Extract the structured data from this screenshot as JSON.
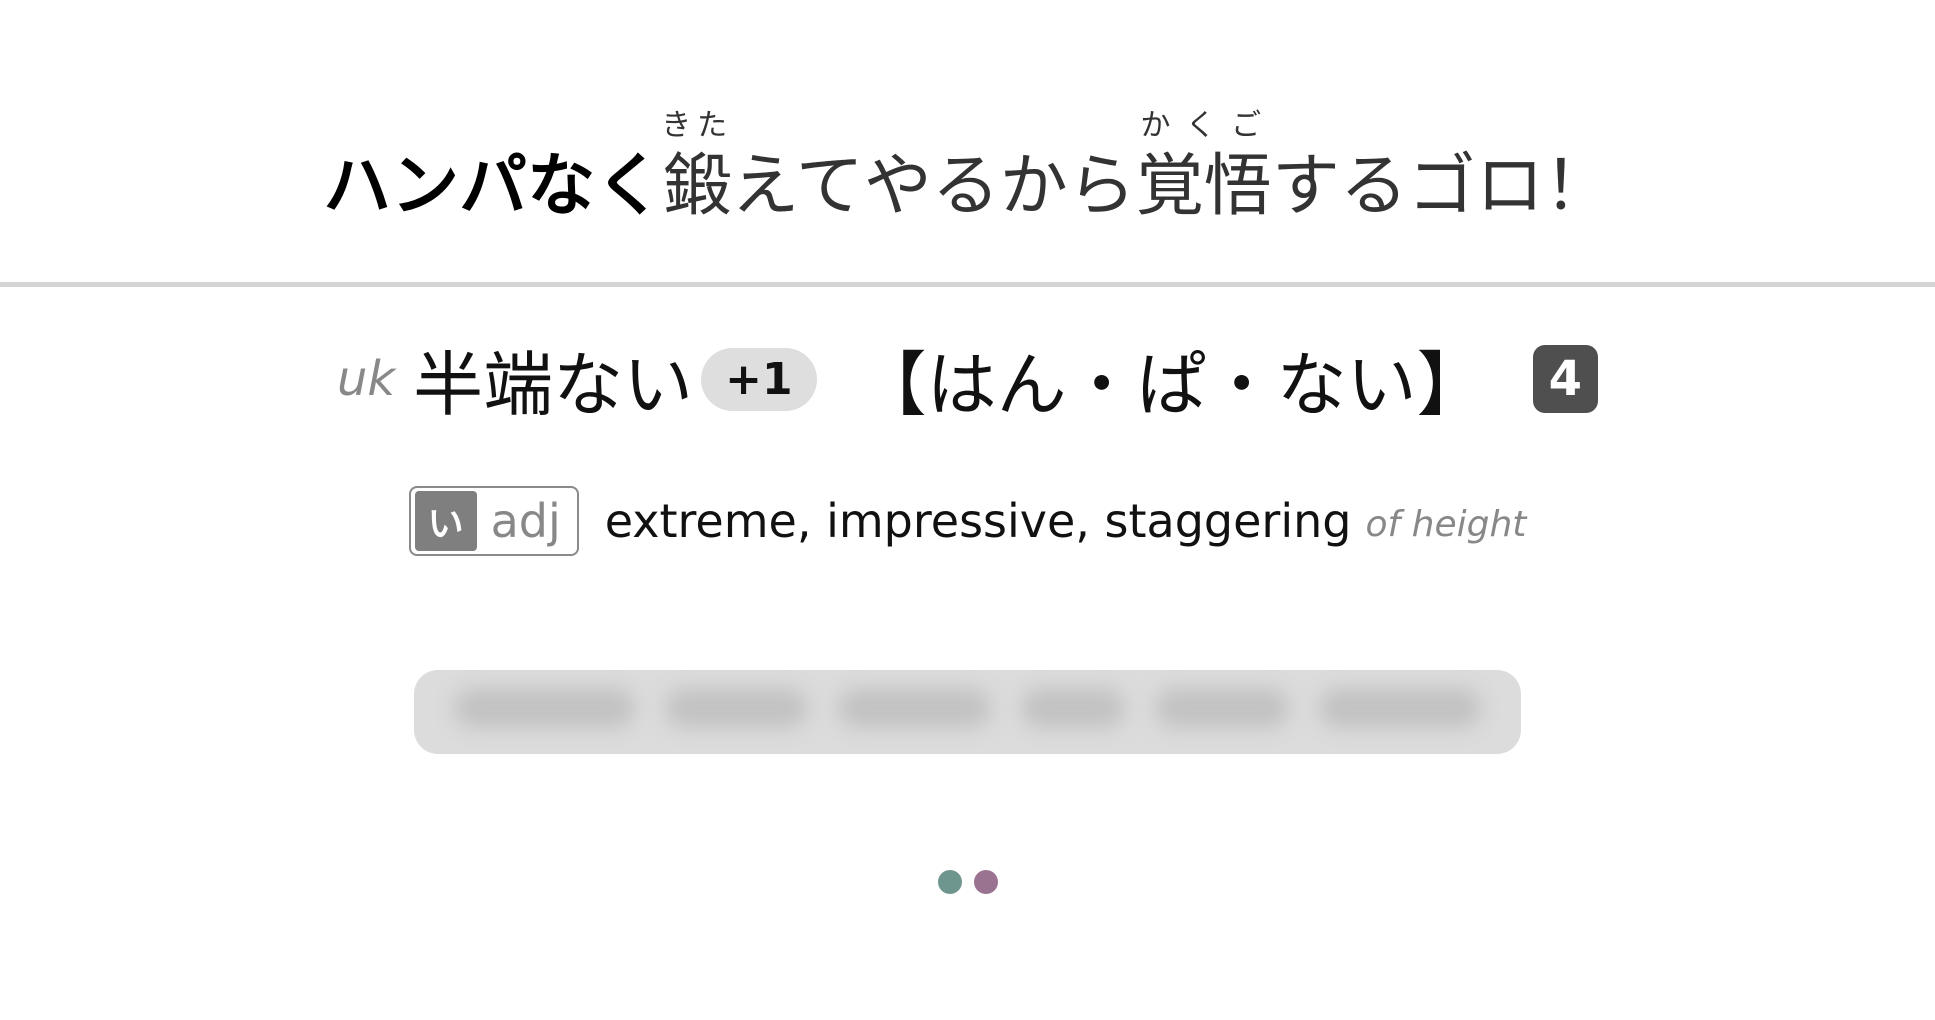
{
  "sentence": {
    "highlight": "ハンパなく",
    "kanji_1": "鍛",
    "furigana_1": "きた",
    "middle": "えてやるから",
    "kanji_2": "覚悟",
    "furigana_2": "かくご",
    "ending": "するゴロ！"
  },
  "headword": {
    "usage_tag": "uk",
    "kanji": "半端ない",
    "extra_forms": "+1",
    "reading": "【はん・ぱ・ない】",
    "count": "4"
  },
  "definition": {
    "pos_kana": "い",
    "pos_label": "adj",
    "gloss": "extreme, impressive, staggering",
    "note": "of height"
  },
  "colors": {
    "dot_1": "#6f968e",
    "dot_2": "#9a7391",
    "badge": "#4f4f4f",
    "divider": "#d4d4d4"
  }
}
